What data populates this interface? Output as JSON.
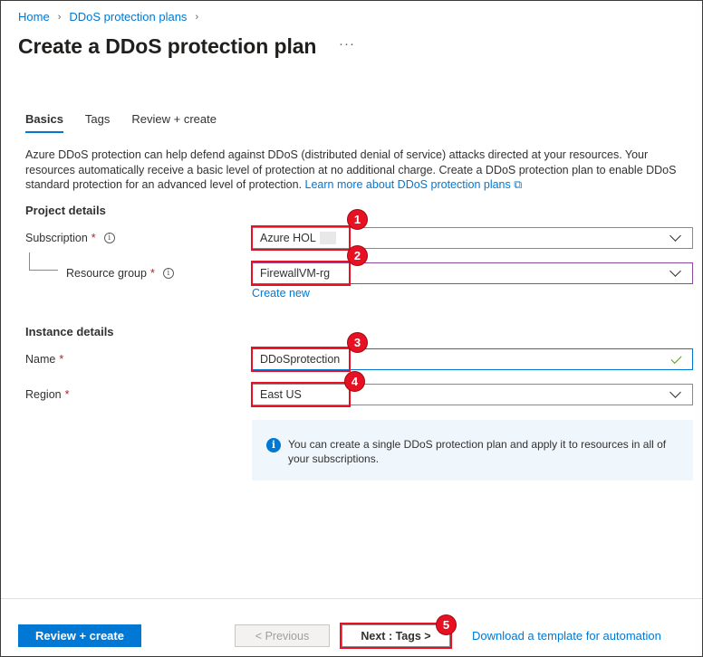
{
  "breadcrumb": {
    "home": "Home",
    "parent": "DDoS protection plans",
    "sep": "›"
  },
  "page": {
    "title": "Create a DDoS protection plan",
    "more": "···"
  },
  "tabs": [
    {
      "label": "Basics",
      "active": true
    },
    {
      "label": "Tags",
      "active": false
    },
    {
      "label": "Review + create",
      "active": false
    }
  ],
  "description": {
    "text": "Azure DDoS protection can help defend against DDoS (distributed denial of service) attacks directed at your resources. Your resources automatically receive a basic level of protection at no additional charge. Create a DDoS protection plan to enable DDoS standard protection for an advanced level of protection. ",
    "link": "Learn more about DDoS protection plans",
    "link_icon": "external-link-icon"
  },
  "project_details": {
    "title": "Project details",
    "subscription": {
      "label": "Subscription",
      "value": "Azure HOL"
    },
    "resource_group": {
      "label": "Resource group",
      "value": "FirewallVM-rg"
    },
    "create_new": "Create new"
  },
  "instance_details": {
    "title": "Instance details",
    "name": {
      "label": "Name",
      "value": "DDoSprotection"
    },
    "region": {
      "label": "Region",
      "value": "East US"
    }
  },
  "required_mark": "*",
  "info_message": "You can create a single DDoS protection plan and apply it to resources in all of your subscriptions.",
  "footer": {
    "review_create": "Review + create",
    "previous": "< Previous",
    "next": "Next : Tags >",
    "download": "Download a template for automation"
  },
  "annotations": [
    "1",
    "2",
    "3",
    "4",
    "5"
  ],
  "colors": {
    "accent": "#0078d4",
    "annotation": "#e81123",
    "required": "#a4262c",
    "valid": "#57a300"
  }
}
